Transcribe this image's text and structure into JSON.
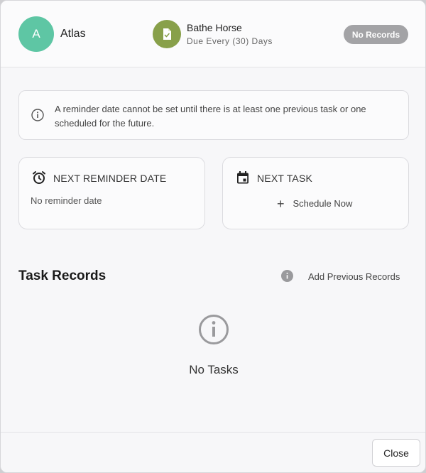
{
  "header": {
    "avatar_initial": "A",
    "pet_name": "Atlas",
    "task_title": "Bathe Horse",
    "task_frequency": "Due Every (30) Days",
    "status_badge": "No Records",
    "task_icon": "clipboard-check-icon"
  },
  "notice": {
    "icon": "info-icon",
    "text": "A reminder date cannot be set until there is at least one previous task or one scheduled for the future."
  },
  "reminder_card": {
    "icon": "alarm-clock-icon",
    "title": "NEXT REMINDER DATE",
    "value": "No reminder date"
  },
  "next_task_card": {
    "icon": "calendar-icon",
    "title": "NEXT TASK",
    "action_label": "Schedule Now"
  },
  "records": {
    "title": "Task Records",
    "help_icon": "info-filled-icon",
    "add_label": "Add Previous Records",
    "empty_icon": "info-icon",
    "empty_text": "No Tasks"
  },
  "footer": {
    "close_label": "Close"
  },
  "colors": {
    "avatar": "#5ec6a4",
    "task_icon": "#88a04a",
    "badge": "#a3a3a6"
  }
}
